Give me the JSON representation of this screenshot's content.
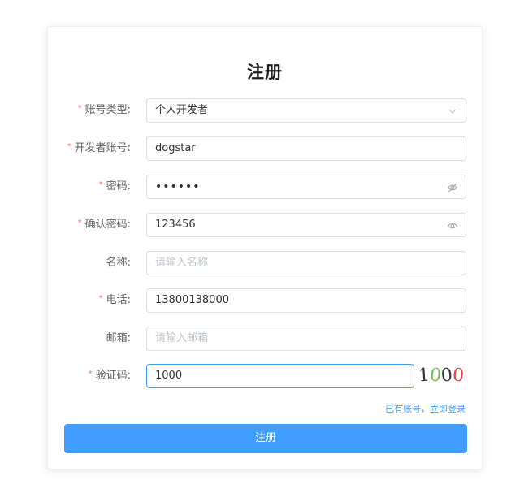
{
  "form": {
    "title": "注册",
    "fields": [
      {
        "label": "账号类型:",
        "required": true,
        "value": "个人开发者",
        "placeholder": "",
        "suffix": "chevron-down-icon"
      },
      {
        "label": "开发者账号:",
        "required": true,
        "value": "dogstar",
        "placeholder": "",
        "suffix": ""
      },
      {
        "label": "密码:",
        "required": true,
        "value": "••••••",
        "placeholder": "",
        "suffix": "eye-off-icon"
      },
      {
        "label": "确认密码:",
        "required": true,
        "value": "123456",
        "placeholder": "",
        "suffix": "eye-icon"
      },
      {
        "label": "名称:",
        "required": false,
        "value": "",
        "placeholder": "请输入名称",
        "suffix": ""
      },
      {
        "label": "电话:",
        "required": true,
        "value": "13800138000",
        "placeholder": "",
        "suffix": ""
      },
      {
        "label": "邮箱:",
        "required": false,
        "value": "",
        "placeholder": "请输入邮箱",
        "suffix": ""
      },
      {
        "label": "验证码:",
        "required": true,
        "value": "1000",
        "placeholder": "",
        "suffix": ""
      }
    ],
    "captcha": {
      "digits": [
        "1",
        "0",
        "0",
        "0"
      ],
      "colors": [
        "#333333",
        "#6cc24a",
        "#333333",
        "#e0443e"
      ]
    },
    "login_link": "已有账号，立即登录",
    "submit_label": "注册"
  },
  "colors": {
    "primary": "#409eff",
    "required": "#f56c6c",
    "border": "#dcdfe6",
    "placeholder": "#c0c4cc"
  }
}
